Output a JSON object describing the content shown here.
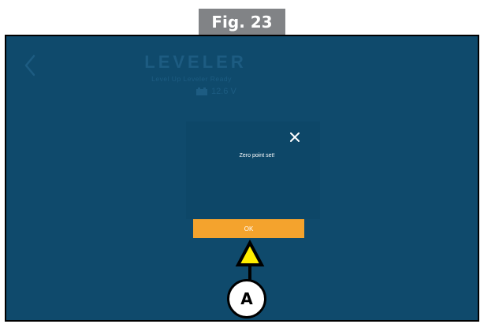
{
  "figure": {
    "label": "Fig. 23"
  },
  "header": {
    "title": "LEVELER",
    "subtitle": "Level Up Leveler Ready",
    "battery_voltage": "12.6 V",
    "back_icon": "chevron-left-icon",
    "battery_icon": "battery-icon"
  },
  "dialog": {
    "message": "Zero point set!",
    "ok_label": "OK",
    "close_icon": "close-icon"
  },
  "callout": {
    "label": "A"
  },
  "colors": {
    "screen_background": "#0f4a6c",
    "dimmed_text": "#1d5c82",
    "ok_button": "#f4a32d",
    "callout_arrow_fill": "#ffee00",
    "figure_label_background": "#818386"
  }
}
